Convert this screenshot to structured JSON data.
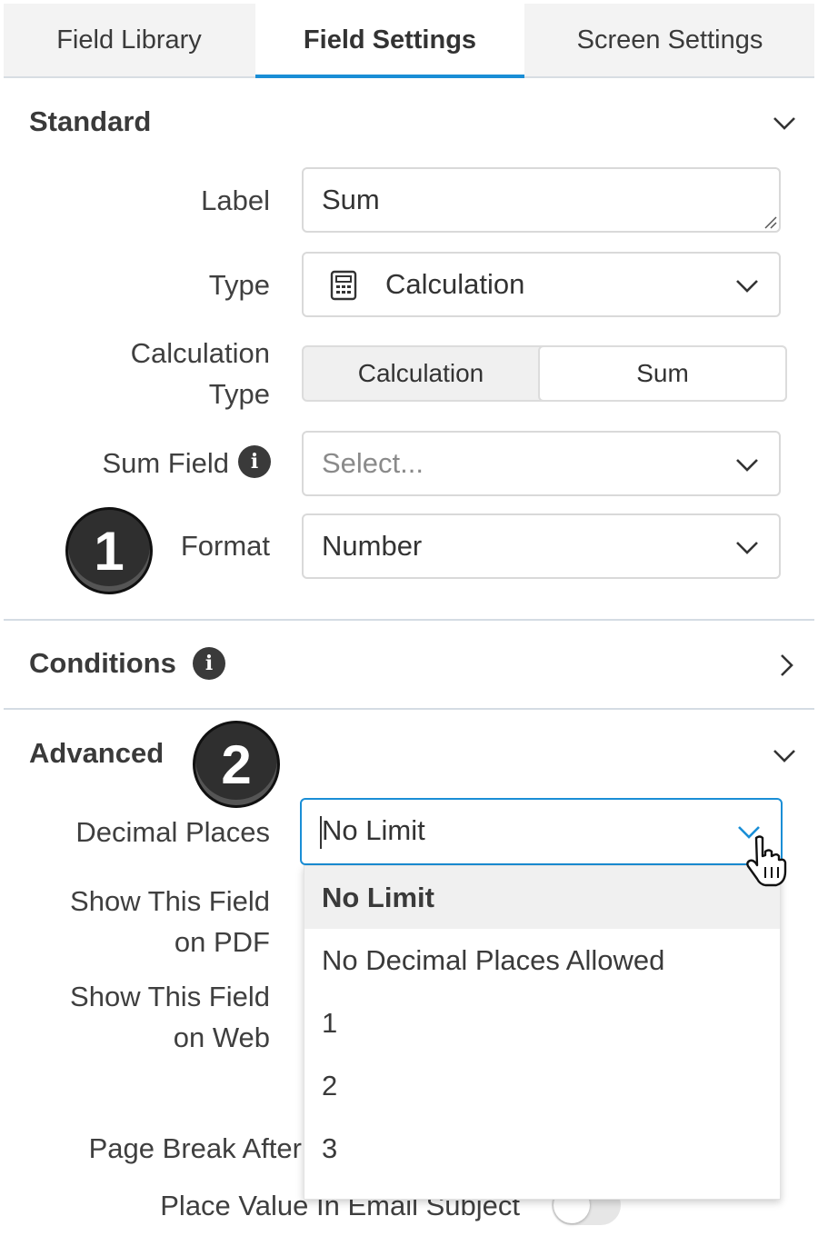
{
  "tabs": [
    {
      "label": "Field Library"
    },
    {
      "label": "Field Settings",
      "active": true
    },
    {
      "label": "Screen Settings"
    }
  ],
  "standard": {
    "title": "Standard",
    "label_field": {
      "label": "Label",
      "value": "Sum"
    },
    "type_field": {
      "label": "Type",
      "value": "Calculation",
      "icon": "calculator-icon"
    },
    "calc_type": {
      "label_line1": "Calculation",
      "label_line2": "Type",
      "options": [
        "Calculation",
        "Sum"
      ],
      "selected": "Sum"
    },
    "sum_field": {
      "label": "Sum Field",
      "placeholder": "Select..."
    },
    "format_field": {
      "label": "Format",
      "value": "Number"
    }
  },
  "conditions": {
    "title": "Conditions"
  },
  "advanced": {
    "title": "Advanced",
    "decimal_places": {
      "label": "Decimal Places",
      "value": "No Limit"
    },
    "show_pdf": {
      "label_line1": "Show This Field",
      "label_line2": "on PDF"
    },
    "show_web": {
      "label_line1": "Show This Field",
      "label_line2": "on Web"
    },
    "page_break": {
      "label": "Page Break After"
    },
    "email_subject": {
      "label": "Place Value In Email Subject",
      "toggle_on": false
    }
  },
  "dropdown": {
    "options": [
      "No Limit",
      "No Decimal Places Allowed",
      "1",
      "2",
      "3"
    ],
    "selected": "No Limit"
  },
  "annotations": {
    "badge1": "1",
    "badge2": "2"
  },
  "colors": {
    "accent": "#1a8ed6",
    "text": "#333333",
    "badge": "#2f2f2f"
  }
}
